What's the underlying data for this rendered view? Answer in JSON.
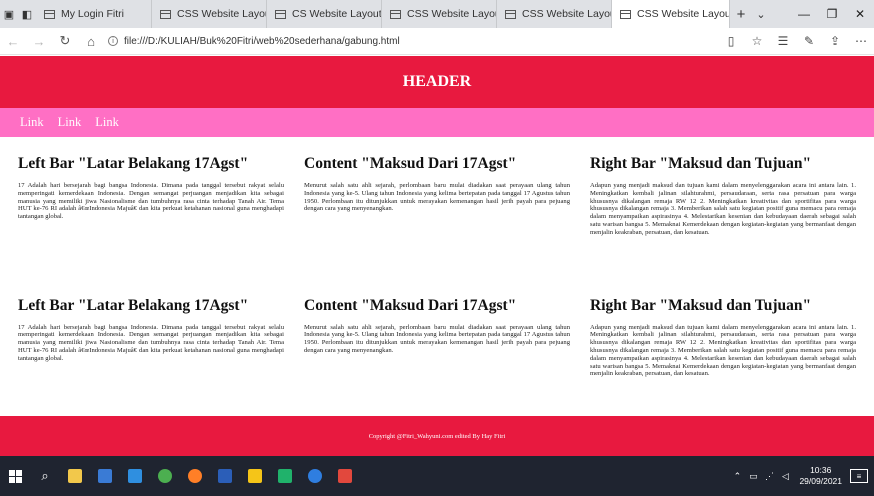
{
  "browser": {
    "tabs": [
      {
        "title": "My Login Fitri",
        "active": false
      },
      {
        "title": "CSS Website Layout",
        "active": false
      },
      {
        "title": "CS Website Layout",
        "active": false
      },
      {
        "title": "CSS Website Layout",
        "active": false
      },
      {
        "title": "CSS Website Layout",
        "active": false
      },
      {
        "title": "CSS Website Layou",
        "active": true
      }
    ],
    "new_tab": "+",
    "url": "file:///D:/KULIAH/Buk%20Fitri/web%20sederhana/gabung.html"
  },
  "page": {
    "header": "HEADER",
    "nav_links": [
      "Link",
      "Link",
      "Link"
    ],
    "sections": [
      {
        "left_title": "Left Bar \"Latar Belakang 17Agst\"",
        "left_text": "17 Adalah hari bersejarah bagi bangsa Indonesia. Dimana pada tanggal tersebut rakyat selalu memperingati kemerdekaan Indonesia. Dengan semangat perjuangan menjadikan kita sebagai manusia yang memiliki jiwa Nasionalisme dan tumbuhnya rasa cinta terhadap Tanah Air. Tema HUT ke-76 RI adalah â€œIndonesia Majuâ€ dan kita perkuat ketahanan nasional guna menghadapi tantangan global.",
        "content_title": "Content \"Maksud Dari 17Agst\"",
        "content_text": "Menurut salah satu ahli sejarah, perlombaan baru mulai diadakan saat perayaan ulang tahun Indonesia yang ke-5. Ulang tahun Indonesia yang kelima bertepatan pada tanggal 17 Agustus tahun 1950. Perlombaan itu ditunjukkan untuk merayakan kemenangan hasil jerih payah para pejuang dengan cara yang menyenangkan.",
        "right_title": "Right Bar \"Maksud dan Tujuan\"",
        "right_text": "Adapun yang menjadi maksud dan tujuan kami dalam menyelenggarakan acara ini antara lain. 1. Meningkatkan kembali jalinan silahturahmi, persaudaraan, serta rasa persatuan para warga khususnya dikalangan remaja RW 12 2. Meningkatkan kreativitas dan sportifitas para warga khususnya dikalangan remaja 3. Memberikan salah satu kegiatan positif guna memacu para remaja dalam menyampaikan aspirasinya 4. Melestarikan kesenian dan kebudayaan daerah sebagai salah satu warisan bangsa 5. Memaknai Kemerdekaan dengan kegiatan-kegiatan yang bermanfaat dengan menjalin keakraban, persatuan, dan kesatuan."
      },
      {
        "left_title": "Left Bar \"Latar Belakang 17Agst\"",
        "left_text": "17 Adalah hari bersejarah bagi bangsa Indonesia. Dimana pada tanggal tersebut rakyat selalu memperingati kemerdekaan Indonesia. Dengan semangat perjuangan menjadikan kita sebagai manusia yang memiliki jiwa Nasionalisme dan tumbuhnya rasa cinta terhadap Tanah Air. Tema HUT ke-76 RI adalah â€œIndonesia Majuâ€ dan kita perkuat ketahanan nasional guna menghadapi tantangan global.",
        "content_title": "Content \"Maksud Dari 17Agst\"",
        "content_text": "Menurut salah satu ahli sejarah, perlombaan baru mulai diadakan saat perayaan ulang tahun Indonesia yang ke-5. Ulang tahun Indonesia yang kelima bertepatan pada tanggal 17 Agustus tahun 1950. Perlombaan itu ditunjukkan untuk merayakan kemenangan hasil jerih payah para pejuang dengan cara yang menyenangkan.",
        "right_title": "Right Bar \"Maksud dan Tujuan\"",
        "right_text": "Adapun yang menjadi maksud dan tujuan kami dalam menyelenggarakan acara ini antara lain. 1. Meningkatkan kembali jalinan silahturahmi, persaudaraan, serta rasa persatuan para warga khususnya dikalangan remaja RW 12 2. Meningkatkan kreativitas dan sportifitas para warga khususnya dikalangan remaja 3. Memberikan salah satu kegiatan positif guna memacu para remaja dalam menyampaikan aspirasinya 4. Melestarikan kesenian dan kebudayaan daerah sebagai salah satu warisan bangsa 5. Memaknai Kemerdekaan dengan kegiatan-kegiatan yang bermanfaat dengan menjalin keakraban, persatuan, dan kesatuan."
      }
    ],
    "footer": "Copyright @Fitri_Wahyuni.com edited By Hay Fitri"
  },
  "taskbar": {
    "apps": [
      "file-explorer-icon",
      "store-icon",
      "mail-icon",
      "chrome-icon",
      "firefox-icon",
      "word-icon",
      "bolt-icon",
      "sketch-icon",
      "edge-icon",
      "office-icon"
    ],
    "time": "10:36",
    "date": "29/09/2021"
  },
  "colors": {
    "header_red": "#e8193f",
    "nav_pink": "#ff6fc4",
    "taskbar": "#1f2430"
  }
}
